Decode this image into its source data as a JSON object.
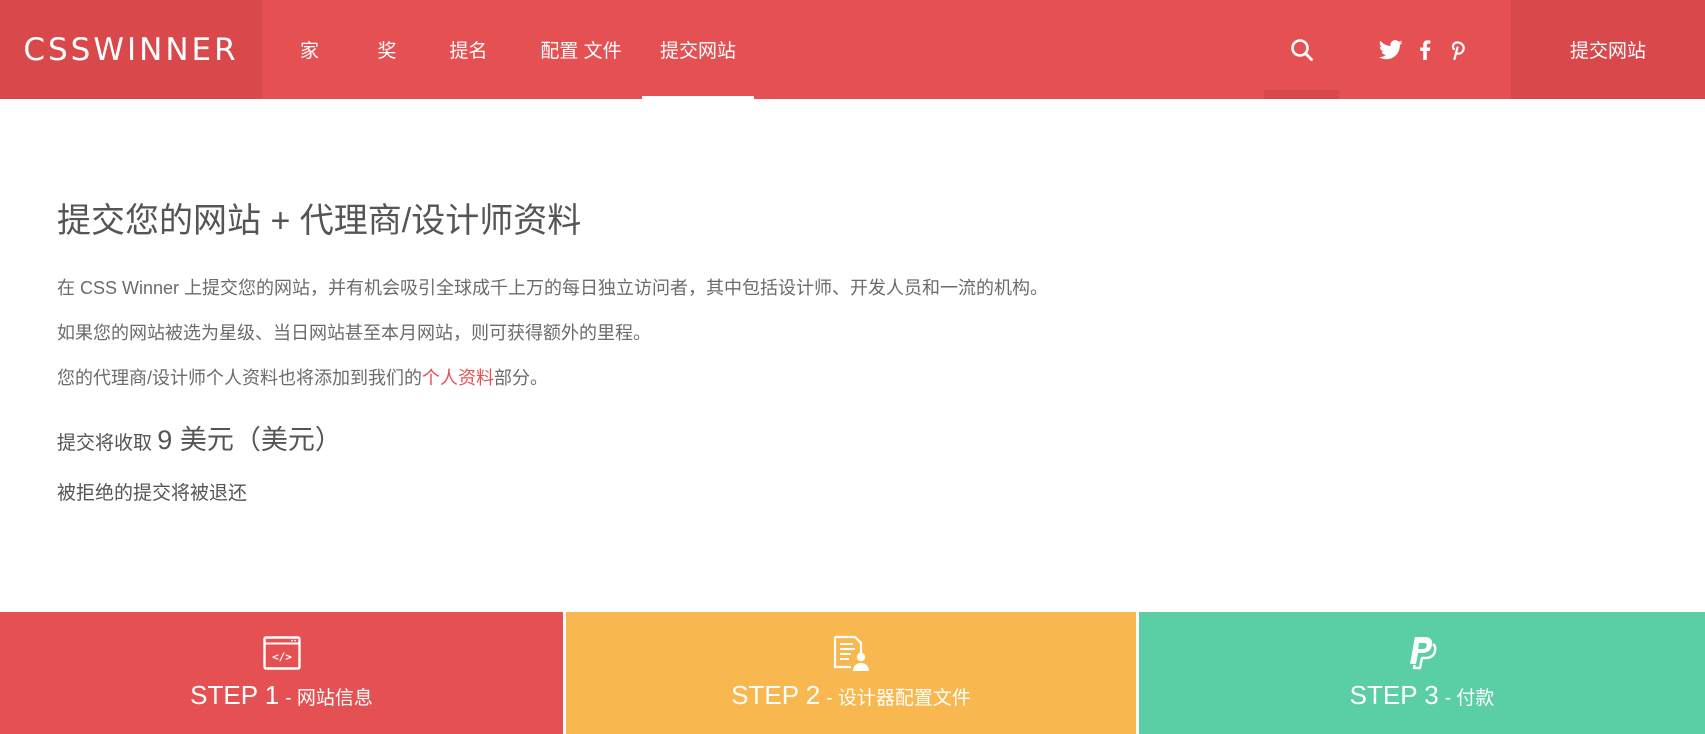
{
  "header": {
    "logo": "CSSWINNER",
    "nav": [
      {
        "label": "家"
      },
      {
        "label": "奖"
      },
      {
        "label": "提名"
      },
      {
        "label": "配置 文件"
      },
      {
        "label": "提交网站"
      }
    ],
    "active_nav": "提交网站",
    "search_icon": "search-icon",
    "social": [
      "twitter-icon",
      "facebook-icon",
      "pinterest-icon"
    ],
    "submit_button": "提交网站"
  },
  "main": {
    "title": "提交您的网站 + 代理商/设计师资料",
    "para1": "在 CSS Winner 上提交您的网站，并有机会吸引全球成千上万的每日独立访问者，其中包括设计师、开发人员和一流的机构。",
    "para2": "如果您的网站被选为星级、当日网站甚至本月网站，则可获得额外的里程。",
    "para3_before": "您的代理商/设计师个人资料也将添加到我们的",
    "para3_link": "个人资料",
    "para3_after": "部分。",
    "fee_prefix": "提交将收取",
    "fee_amount": "9 美元（美元）",
    "refund": "被拒绝的提交将被退还"
  },
  "steps": [
    {
      "num": "STEP 1",
      "sub": "- 网站信息",
      "icon": "code-window-icon",
      "color": "#e55152"
    },
    {
      "num": "STEP 2",
      "sub": "- 设计器配置文件",
      "icon": "profile-document-icon",
      "color": "#f8b84f"
    },
    {
      "num": "STEP 3",
      "sub": "- 付款",
      "icon": "paypal-icon",
      "color": "#5acfa4"
    }
  ],
  "colors": {
    "brand_red": "#e55152",
    "brand_red_dark": "#d9484a",
    "step_orange": "#f8b84f",
    "step_green": "#5acfa4"
  }
}
